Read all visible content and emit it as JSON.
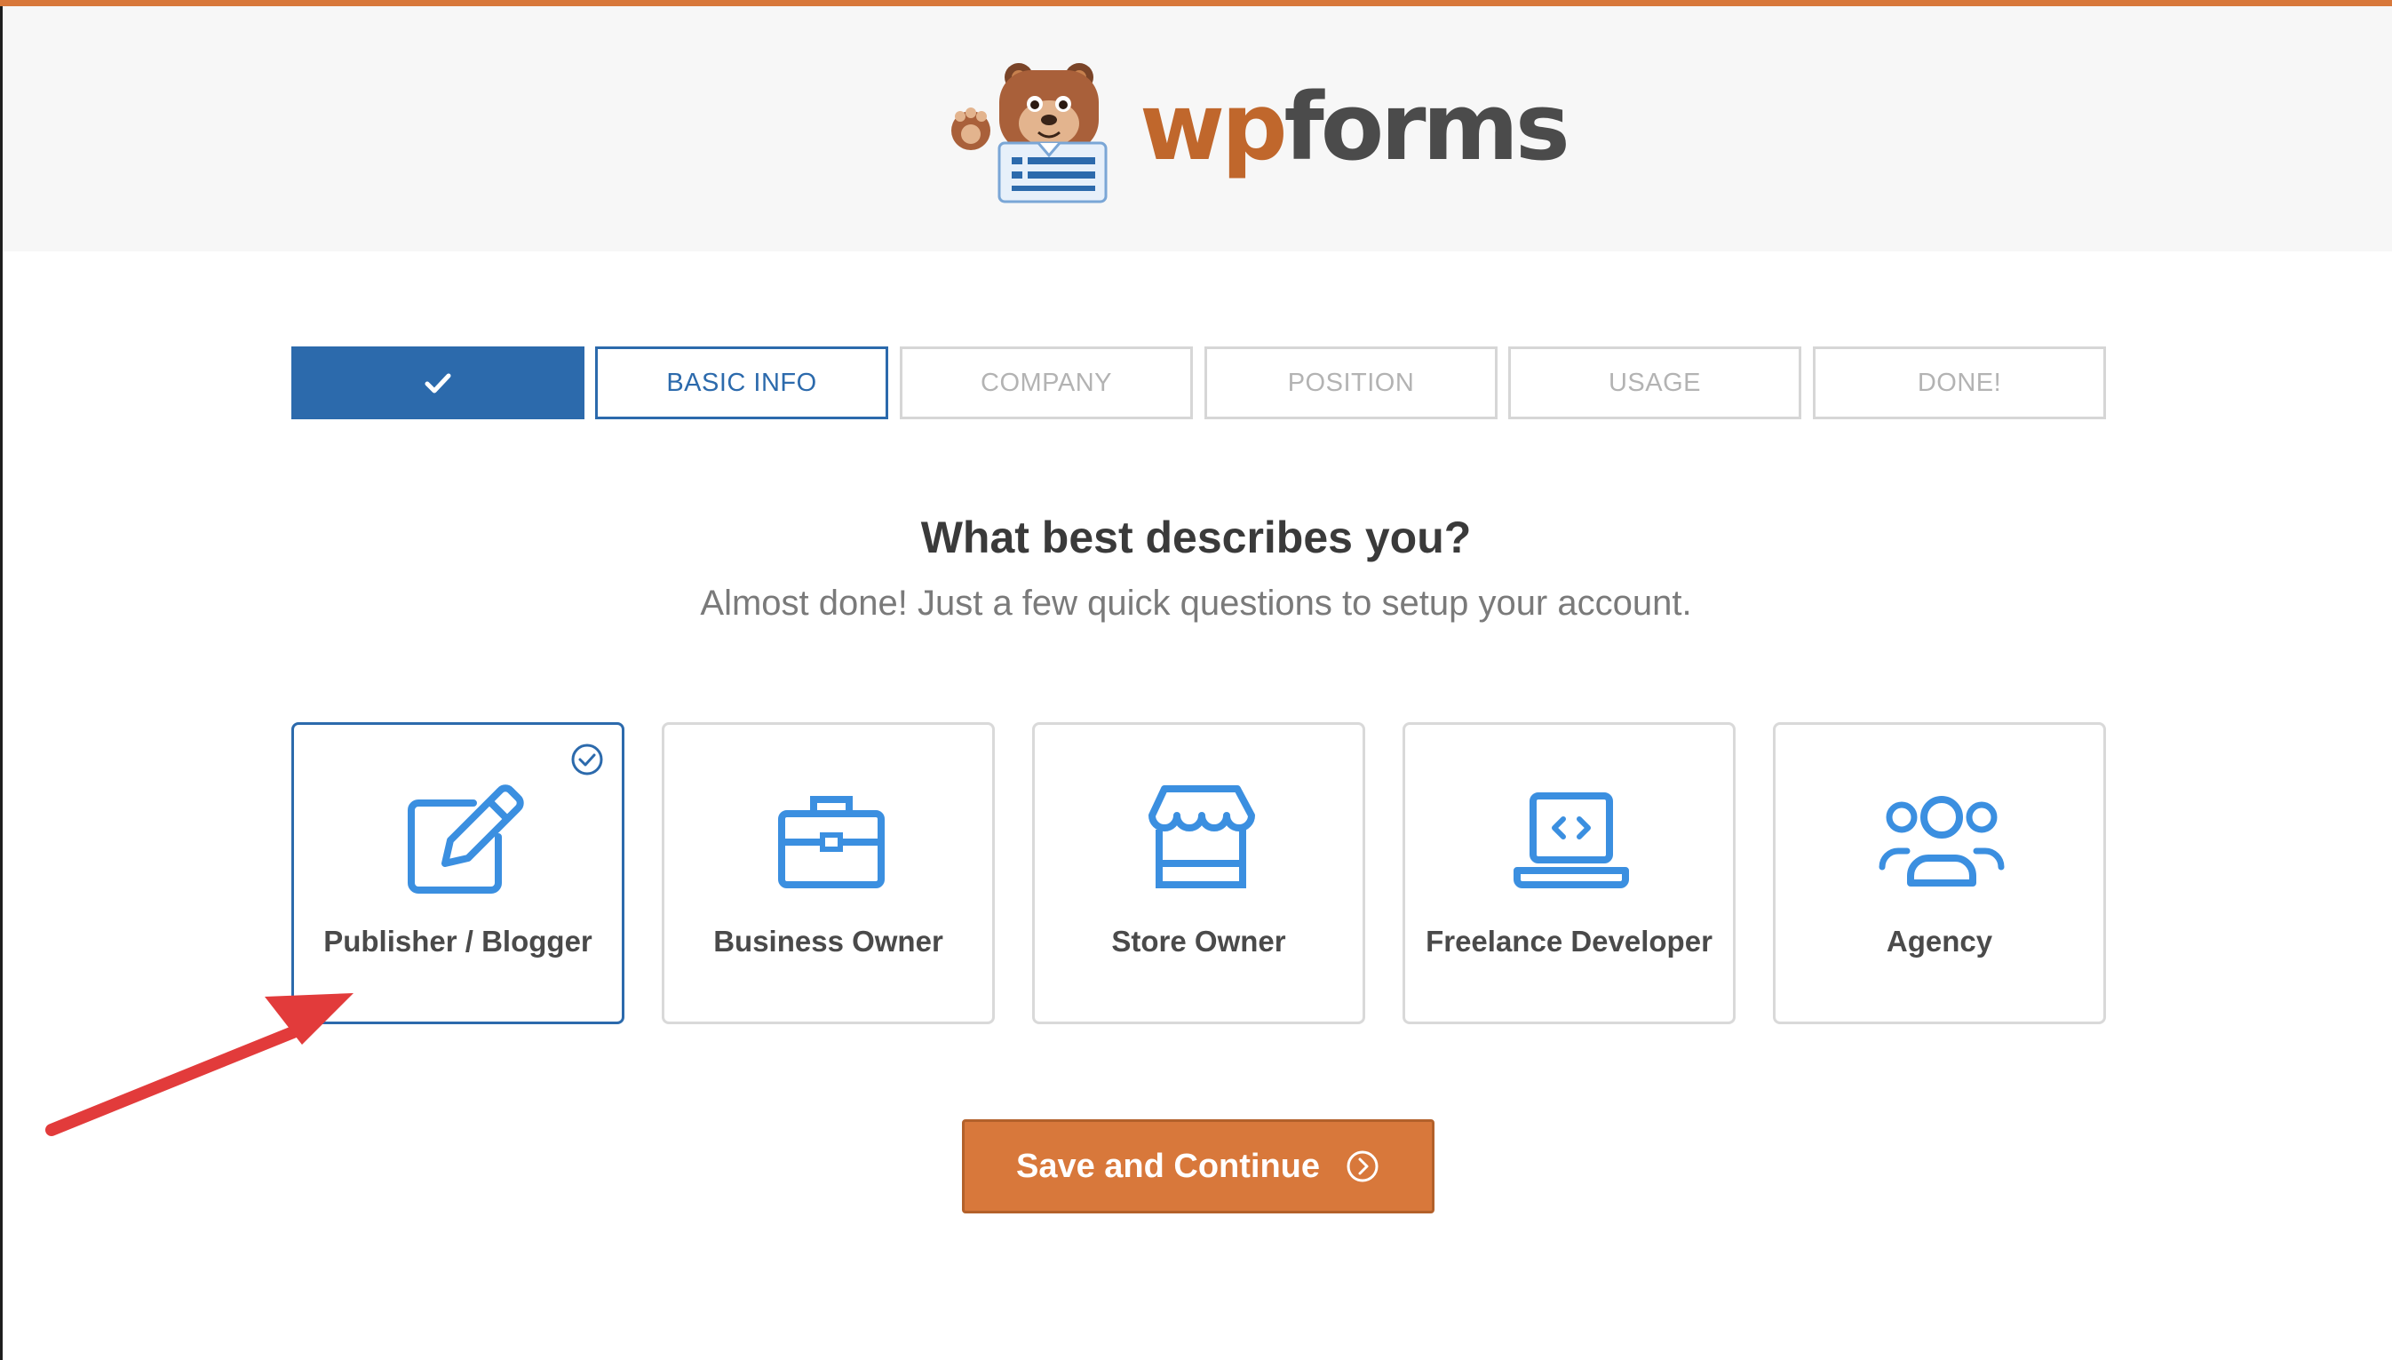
{
  "colors": {
    "accent_orange": "#d8783b",
    "brand_blue": "#2c6aac",
    "annotation_red": "#e23b3b"
  },
  "logo": {
    "wp": "wp",
    "forms": "forms",
    "mascot_icon": "bear-mascot-icon"
  },
  "steps": [
    {
      "label": "",
      "icon": "check-icon",
      "state": "completed"
    },
    {
      "label": "BASIC INFO",
      "state": "active"
    },
    {
      "label": "COMPANY",
      "state": "inactive"
    },
    {
      "label": "POSITION",
      "state": "inactive"
    },
    {
      "label": "USAGE",
      "state": "inactive"
    },
    {
      "label": "DONE!",
      "state": "inactive"
    }
  ],
  "heading": {
    "title": "What best describes you?",
    "subtitle": "Almost done! Just a few quick questions to setup your account."
  },
  "options": [
    {
      "label": "Publisher / Blogger",
      "icon": "edit-pencil-icon",
      "selected": true
    },
    {
      "label": "Business Owner",
      "icon": "briefcase-icon",
      "selected": false
    },
    {
      "label": "Store Owner",
      "icon": "storefront-icon",
      "selected": false
    },
    {
      "label": "Freelance Developer",
      "icon": "laptop-code-icon",
      "selected": false
    },
    {
      "label": "Agency",
      "icon": "users-group-icon",
      "selected": false
    }
  ],
  "save_button": {
    "label": "Save and Continue",
    "icon": "chevron-right-circle-icon"
  }
}
